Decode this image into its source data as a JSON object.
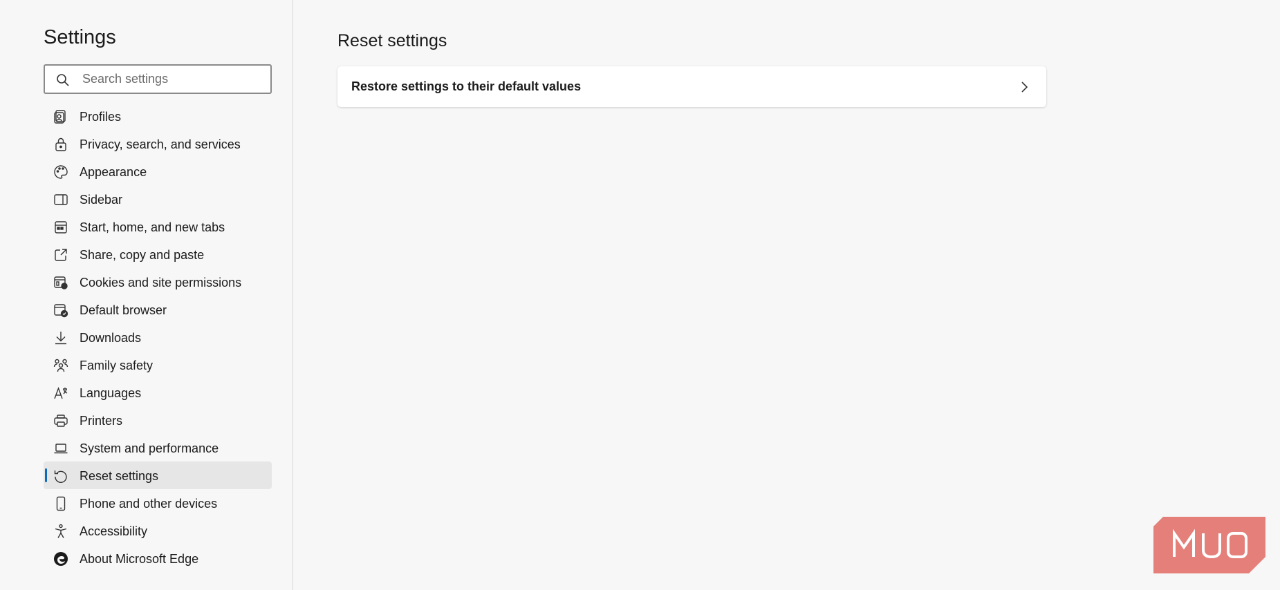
{
  "sidebar": {
    "title": "Settings",
    "search": {
      "placeholder": "Search settings",
      "value": ""
    },
    "items": [
      {
        "label": "Profiles",
        "icon": "profile-icon"
      },
      {
        "label": "Privacy, search, and services",
        "icon": "lock-icon"
      },
      {
        "label": "Appearance",
        "icon": "palette-icon"
      },
      {
        "label": "Sidebar",
        "icon": "sidebar-icon"
      },
      {
        "label": "Start, home, and new tabs",
        "icon": "home-tabs-icon"
      },
      {
        "label": "Share, copy and paste",
        "icon": "share-icon"
      },
      {
        "label": "Cookies and site permissions",
        "icon": "cookies-icon"
      },
      {
        "label": "Default browser",
        "icon": "default-browser-icon"
      },
      {
        "label": "Downloads",
        "icon": "download-icon"
      },
      {
        "label": "Family safety",
        "icon": "family-icon"
      },
      {
        "label": "Languages",
        "icon": "languages-icon"
      },
      {
        "label": "Printers",
        "icon": "printer-icon"
      },
      {
        "label": "System and performance",
        "icon": "laptop-icon"
      },
      {
        "label": "Reset settings",
        "icon": "reset-icon",
        "active": true
      },
      {
        "label": "Phone and other devices",
        "icon": "phone-icon"
      },
      {
        "label": "Accessibility",
        "icon": "accessibility-icon"
      },
      {
        "label": "About Microsoft Edge",
        "icon": "edge-logo-icon"
      }
    ]
  },
  "main": {
    "title": "Reset settings",
    "card": {
      "label": "Restore settings to their default values",
      "icon": "chevron-right-icon"
    }
  },
  "watermark": {
    "text": "MUO",
    "color": "#e06a64"
  },
  "colors": {
    "accent": "#0f6cbd",
    "background": "#f7f7f7",
    "card": "#ffffff",
    "active_item": "#e6e6e6"
  }
}
